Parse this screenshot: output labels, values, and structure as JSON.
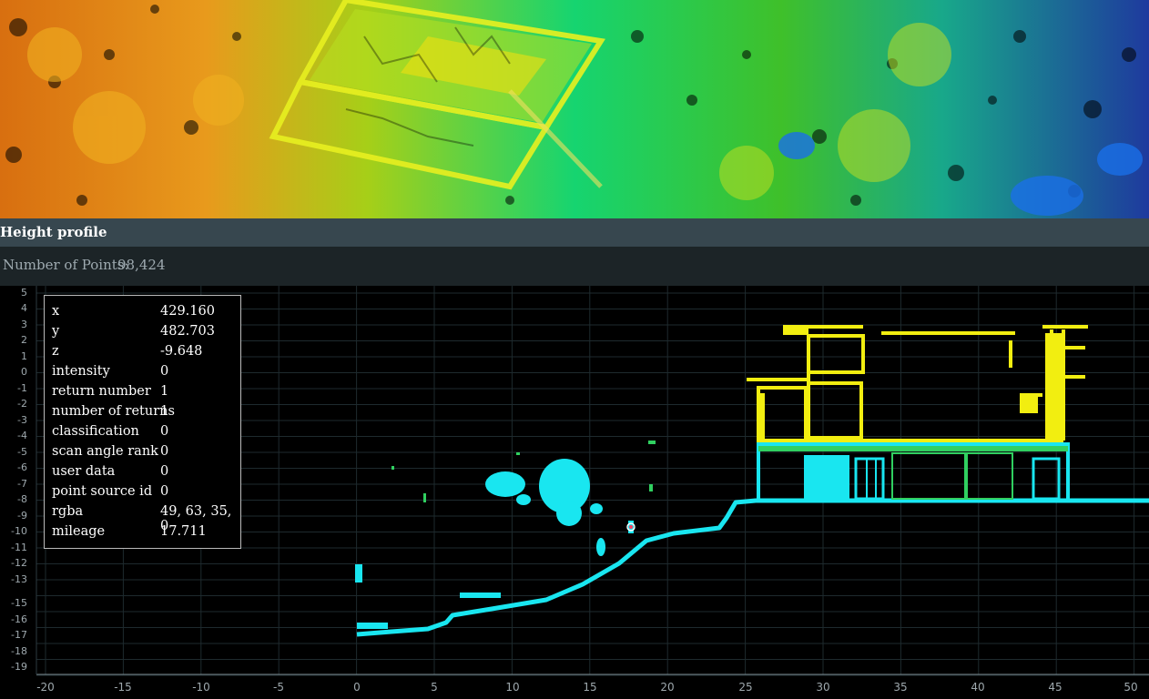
{
  "panel": {
    "title": "Height profile",
    "points_label": "Number of Points:",
    "points_value": "98,424"
  },
  "axes": {
    "y_ticks": [
      "5",
      "4",
      "3",
      "2",
      "1",
      "0",
      "-1",
      "-2",
      "-3",
      "-4",
      "-5",
      "-6",
      "-7",
      "-8",
      "-9",
      "-10",
      "-11",
      "-12",
      "-13",
      "-15",
      "-16",
      "-17",
      "-18",
      "-19"
    ],
    "x_ticks": [
      "-20",
      "-15",
      "-10",
      "-5",
      "0",
      "5",
      "10",
      "15",
      "20",
      "25",
      "30",
      "35",
      "40",
      "45",
      "50"
    ]
  },
  "point_attributes": [
    {
      "name": "x",
      "value": "429.160"
    },
    {
      "name": "y",
      "value": "482.703"
    },
    {
      "name": "z",
      "value": "-9.648"
    },
    {
      "name": "intensity",
      "value": "0"
    },
    {
      "name": "return number",
      "value": "1"
    },
    {
      "name": "number of returns",
      "value": "1"
    },
    {
      "name": "classification",
      "value": "0"
    },
    {
      "name": "scan angle rank",
      "value": "0"
    },
    {
      "name": "user data",
      "value": "0"
    },
    {
      "name": "point source id",
      "value": "0"
    },
    {
      "name": "rgba",
      "value": "49, 63, 35, 0"
    },
    {
      "name": "mileage",
      "value": "17.711"
    }
  ],
  "colors": {
    "title_bar": "#37474f",
    "info_bar": "#1c2427",
    "ground_points": "#19e6f0",
    "upper_points": "#f2ee10",
    "mid_points": "#20d040"
  }
}
